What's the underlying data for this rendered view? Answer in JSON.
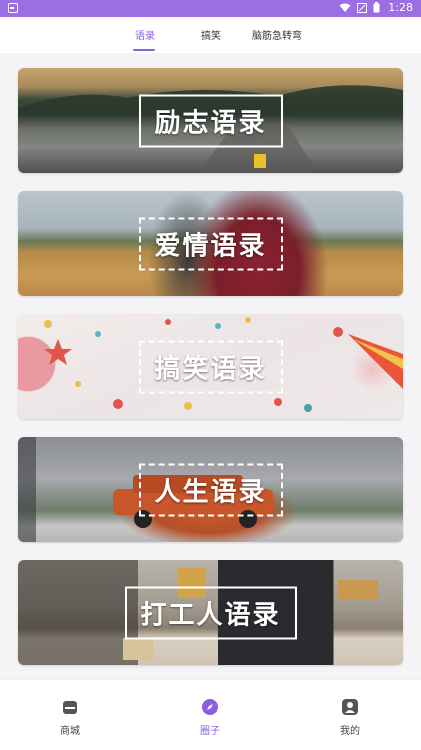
{
  "status_bar": {
    "time": "1:28"
  },
  "tabs": [
    {
      "label": "语录",
      "active": true
    },
    {
      "label": "搞笑",
      "active": false
    },
    {
      "label": "脑筋急转弯",
      "active": false
    }
  ],
  "cards": [
    {
      "title": "励志语录",
      "image": "road-sunset"
    },
    {
      "title": "爱情语录",
      "image": "couple-field"
    },
    {
      "title": "搞笑语录",
      "image": "party-decoration"
    },
    {
      "title": "人生语录",
      "image": "toy-car"
    },
    {
      "title": "打工人语录",
      "image": "desk-laptop"
    }
  ],
  "bottom_nav": [
    {
      "label": "商城",
      "icon": "store-icon",
      "active": false
    },
    {
      "label": "圈子",
      "icon": "compass-icon",
      "active": true
    },
    {
      "label": "我的",
      "icon": "user-icon",
      "active": false
    }
  ],
  "colors": {
    "accent": "#8a5fe0",
    "status_bar": "#9b6fe3"
  }
}
